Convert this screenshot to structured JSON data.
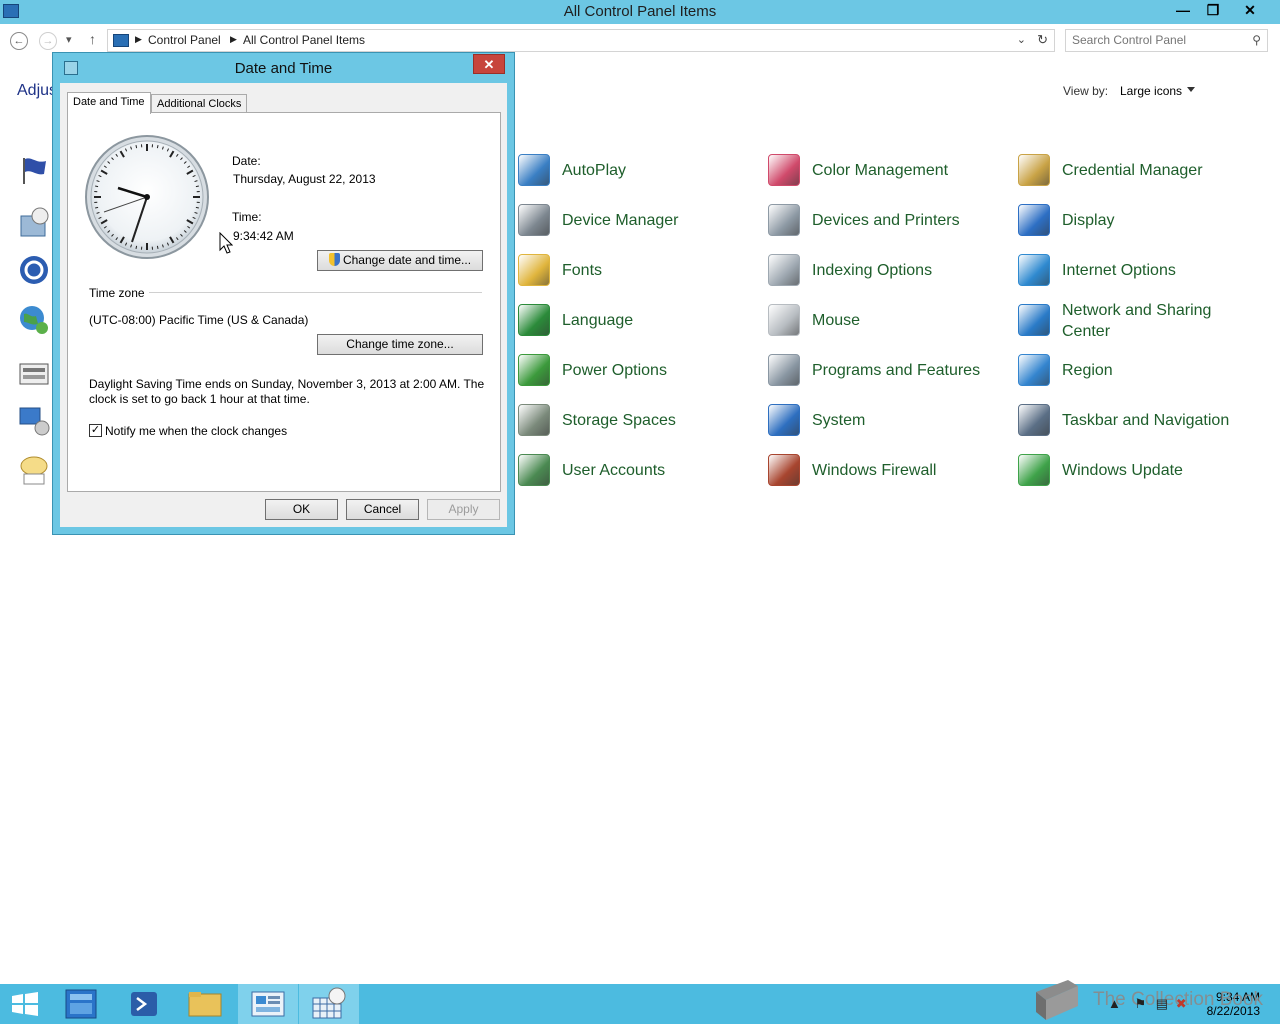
{
  "window": {
    "title": "All Control Panel Items",
    "minimize_icon": "minimize-icon",
    "maximize_icon": "restore-icon",
    "close_icon": "close-icon"
  },
  "address": {
    "crumbs": [
      "Control Panel",
      "All Control Panel Items"
    ],
    "search_placeholder": "Search Control Panel"
  },
  "content": {
    "heading_partial": "Adjus",
    "view_by_label": "View by:",
    "view_by_value": "Large icons"
  },
  "items": [
    {
      "label": "AutoPlay",
      "icon": "autoplay-icon",
      "color": "#3a7fc4"
    },
    {
      "label": "Color Management",
      "icon": "color-management-icon",
      "color": "#d04a6b"
    },
    {
      "label": "Credential Manager",
      "icon": "credential-manager-icon",
      "color": "#c9a346"
    },
    {
      "label": "Device Manager",
      "icon": "device-manager-icon",
      "color": "#7d8790"
    },
    {
      "label": "Devices and Printers",
      "icon": "printer-icon",
      "color": "#8e9aa5"
    },
    {
      "label": "Display",
      "icon": "display-icon",
      "color": "#2d6fc4"
    },
    {
      "label": "Fonts",
      "icon": "fonts-icon",
      "color": "#e0b53d"
    },
    {
      "label": "Indexing Options",
      "icon": "indexing-icon",
      "color": "#9ea8b1"
    },
    {
      "label": "Internet Options",
      "icon": "internet-options-icon",
      "color": "#2f8ad0"
    },
    {
      "label": "Language",
      "icon": "language-icon",
      "color": "#2b8b3a"
    },
    {
      "label": "Mouse",
      "icon": "mouse-icon",
      "color": "#b7bcc1"
    },
    {
      "label": "Network and Sharing\nCenter",
      "icon": "network-icon",
      "color": "#2a7bc8"
    },
    {
      "label": "Power Options",
      "icon": "power-icon",
      "color": "#3c9a3c"
    },
    {
      "label": "Programs and Features",
      "icon": "programs-icon",
      "color": "#8a97a3"
    },
    {
      "label": "Region",
      "icon": "region-icon",
      "color": "#3485cf"
    },
    {
      "label": "Storage Spaces",
      "icon": "storage-icon",
      "color": "#7b8a7b"
    },
    {
      "label": "System",
      "icon": "system-icon",
      "color": "#2e6fc0"
    },
    {
      "label": "Taskbar and Navigation",
      "icon": "taskbar-icon",
      "color": "#5b6f86"
    },
    {
      "label": "User Accounts",
      "icon": "user-accounts-icon",
      "color": "#4b8a52"
    },
    {
      "label": "Windows Firewall",
      "icon": "firewall-icon",
      "color": "#a8452f"
    },
    {
      "label": "Windows Update",
      "icon": "windows-update-icon",
      "color": "#3fa34a"
    }
  ],
  "dialog": {
    "title": "Date and Time",
    "tabs": [
      "Date and Time",
      "Additional Clocks"
    ],
    "date_label": "Date:",
    "date_value": "Thursday, August 22, 2013",
    "time_label": "Time:",
    "time_value": "9:34:42 AM",
    "change_datetime_button": "Change date and time...",
    "timezone_heading": "Time zone",
    "timezone_value": "(UTC-08:00) Pacific Time (US & Canada)",
    "change_timezone_button": "Change time zone...",
    "dst_line1": "Daylight Saving Time ends on Sunday, November 3, 2013 at 2:00 AM. The",
    "dst_line2": "clock is set to go back 1 hour at that time.",
    "notify_label": "Notify me when the clock changes",
    "notify_checked": true,
    "ok_button": "OK",
    "cancel_button": "Cancel",
    "apply_button": "Apply"
  },
  "taskbar": {
    "time": "9:34 AM",
    "date": "8/22/2013",
    "watermark": "The Collection Book"
  }
}
